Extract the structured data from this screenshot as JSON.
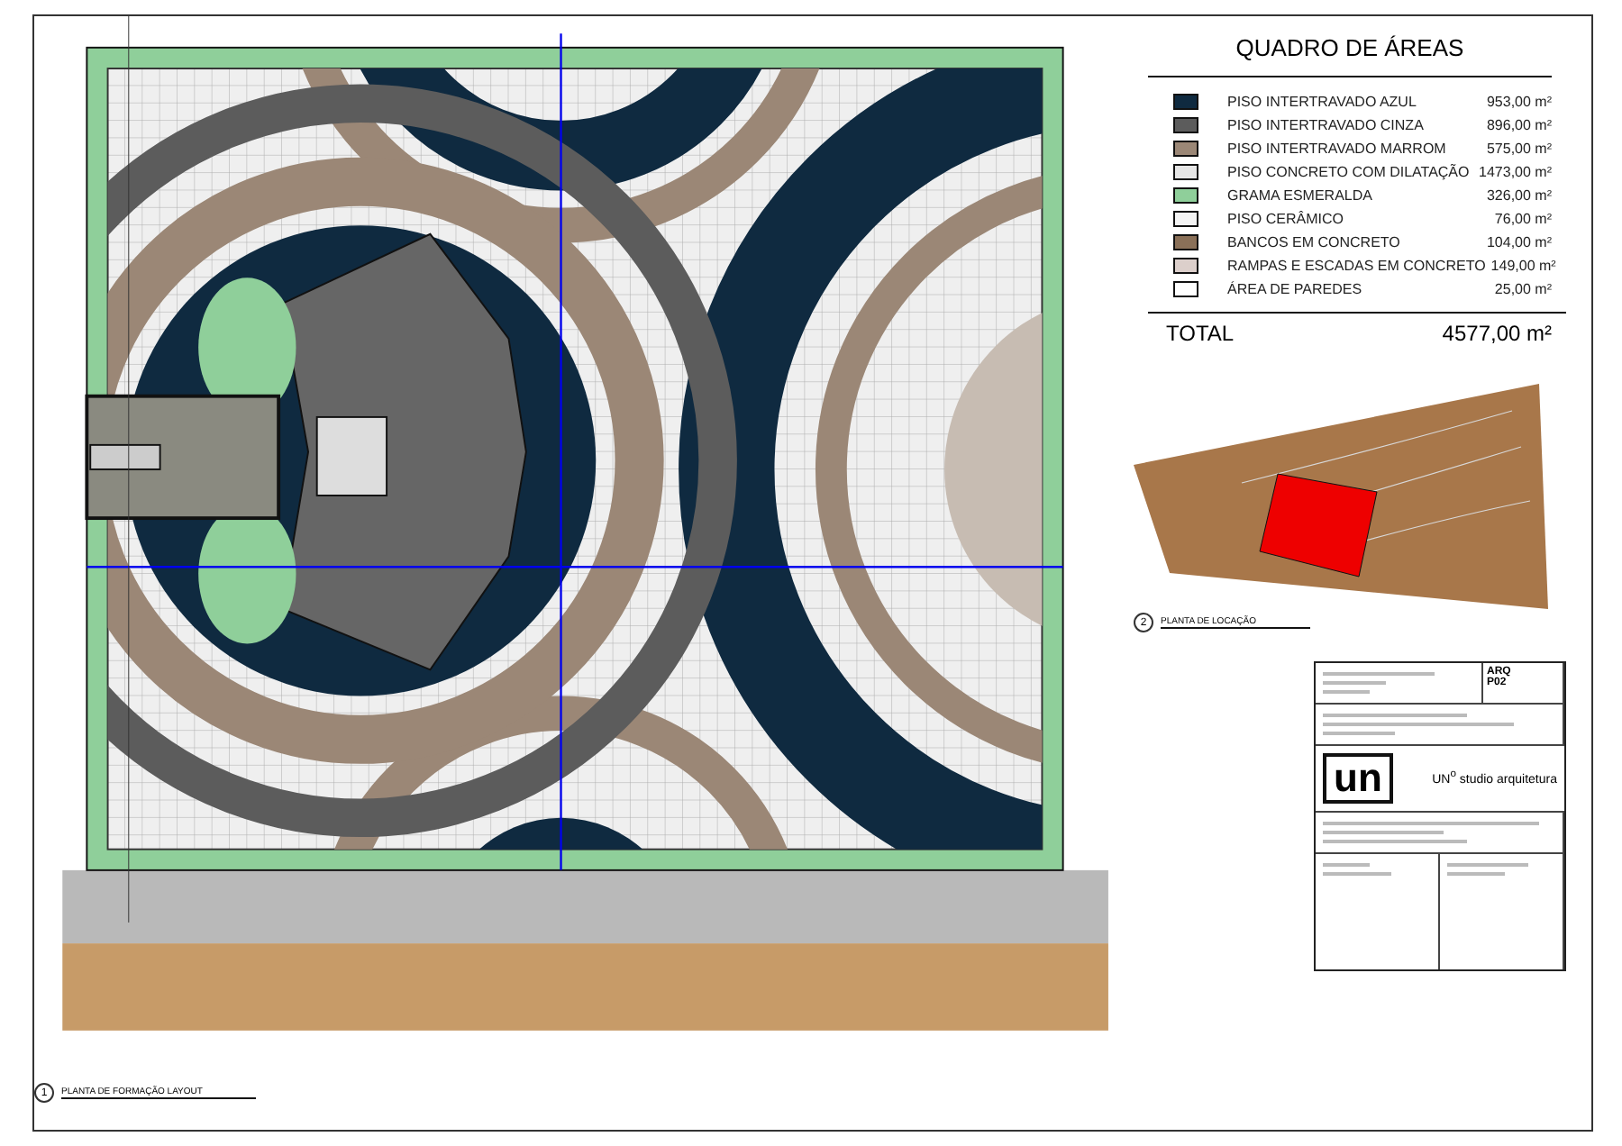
{
  "legend": {
    "title": "QUADRO DE ÁREAS",
    "items": [
      {
        "label": "PISO INTERTRAVADO AZUL",
        "area": "953,00 m²",
        "color": "#0f2a40"
      },
      {
        "label": "PISO INTERTRAVADO CINZA",
        "area": "896,00 m²",
        "color": "#5c5c5c"
      },
      {
        "label": "PISO INTERTRAVADO MARROM",
        "area": "575,00 m²",
        "color": "#9b8776"
      },
      {
        "label": "PISO CONCRETO COM DILATAÇÃO",
        "area": "1473,00 m²",
        "color": "#e6e6e6"
      },
      {
        "label": "GRAMA ESMERALDA",
        "area": "326,00 m²",
        "color": "#8fcf9a"
      },
      {
        "label": "PISO CERÂMICO",
        "area": "76,00 m²",
        "color": "#f4f4f4"
      },
      {
        "label": "BANCOS EM CONCRETO",
        "area": "104,00 m²",
        "color": "#8a7058"
      },
      {
        "label": "RAMPAS E ESCADAS EM CONCRETO",
        "area": "149,00 m²",
        "color": "#dccfcb"
      },
      {
        "label": "ÁREA DE PAREDES",
        "area": "25,00 m²",
        "color": "#ffffff"
      }
    ],
    "total_label": "TOTAL",
    "total_value": "4577,00 m²"
  },
  "location_plan": {
    "number": "2",
    "title": "PLANTA DE LOCAÇÃO"
  },
  "layout_plan": {
    "number": "1",
    "title": "PLANTA DE FORMAÇÃO LAYOUT"
  },
  "title_block": {
    "discipline": "ARQ",
    "sheet": "P02",
    "logo": "un",
    "studio": "UN$^{o}$ studio arquitetura"
  }
}
